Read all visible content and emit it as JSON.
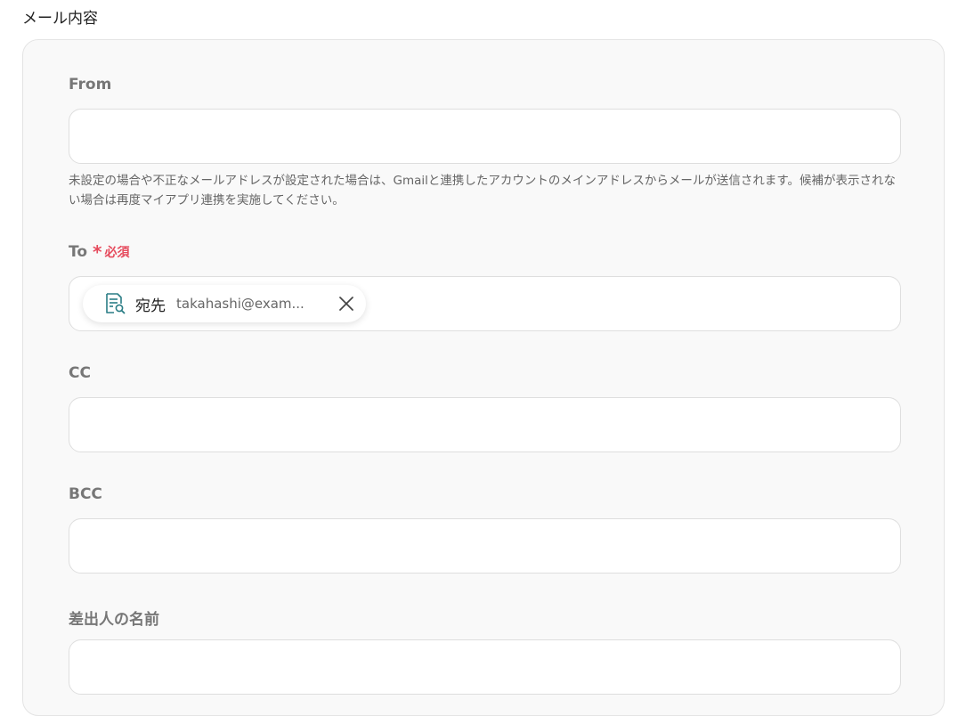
{
  "section_title": "メール内容",
  "fields": {
    "from": {
      "label": "From",
      "value": "",
      "help": "未設定の場合や不正なメールアドレスが設定された場合は、Gmailと連携したアカウントのメインアドレスからメールが送信されます。候補が表示されない場合は再度マイアプリ連携を実施してください。"
    },
    "to": {
      "label": "To",
      "required_mark": "*",
      "required_text": "必須",
      "chip": {
        "name": "宛先",
        "value": "takahashi@exam...",
        "icon": "document-search-icon"
      }
    },
    "cc": {
      "label": "CC",
      "value": ""
    },
    "bcc": {
      "label": "BCC",
      "value": ""
    },
    "sender_name": {
      "label": "差出人の名前",
      "value": ""
    }
  },
  "colors": {
    "required": "#e64b5d",
    "icon_accent": "#2a7d85"
  }
}
